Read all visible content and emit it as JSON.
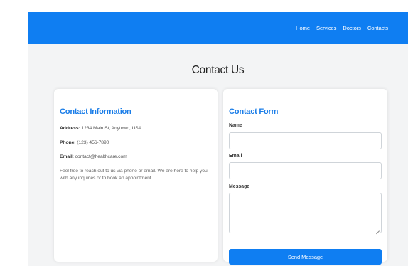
{
  "nav": {
    "links": [
      "Home",
      "Services",
      "Doctors",
      "Contacts"
    ]
  },
  "page_title": "Contact Us",
  "contact_info": {
    "title": "Contact Information",
    "address_label": "Address:",
    "address_value": "1234 Main St, Anytown, USA",
    "phone_label": "Phone:",
    "phone_value": "(123) 456-7890",
    "email_label": "Email:",
    "email_value": "contact@healthcare.com",
    "description": "Feel free to reach out to us via phone or email. We are here to help you with any inquiries or to book an appointment."
  },
  "contact_form": {
    "title": "Contact Form",
    "name_label": "Name",
    "name_value": "",
    "email_label": "Email",
    "email_value": "",
    "message_label": "Message",
    "message_value": "",
    "submit_label": "Send Message"
  },
  "colors": {
    "primary": "#0f7ef2",
    "heading_accent": "#1a7de8",
    "background": "#f3f4f5"
  }
}
